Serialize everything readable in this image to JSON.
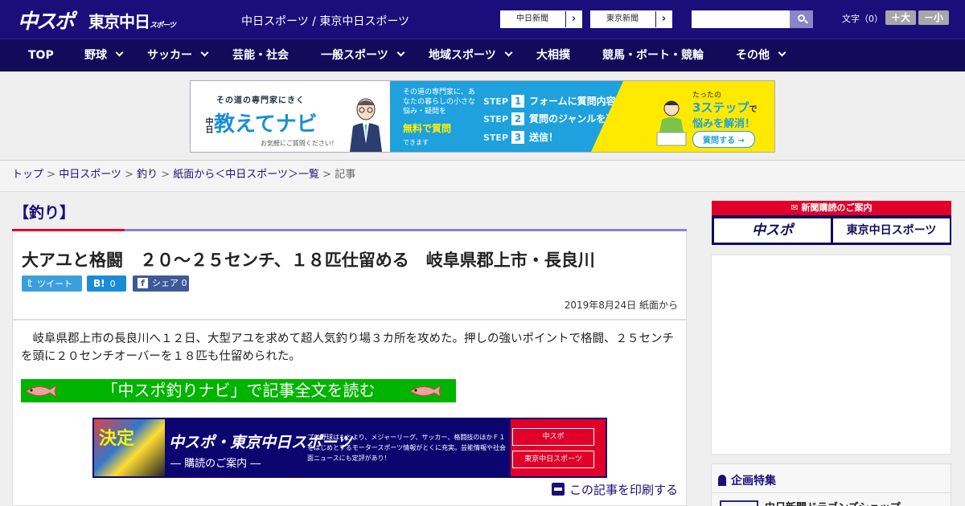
{
  "header": {
    "logo_main": "中スポ",
    "logo_tokyo": "東京中日",
    "logo_tokyo_sub": "スポーツ",
    "site_title": "中日スポーツ / 東京中日スポーツ",
    "ext_links": [
      "中日新聞",
      "東京新聞"
    ],
    "search_placeholder": "",
    "font_size_label": "文字（0）",
    "font_bigger": "＋大",
    "font_smaller": "－小"
  },
  "nav": {
    "items": [
      {
        "label": "TOP",
        "has_menu": false
      },
      {
        "label": "野球",
        "has_menu": true
      },
      {
        "label": "サッカー",
        "has_menu": true
      },
      {
        "label": "芸能・社会",
        "has_menu": false
      },
      {
        "label": "一般スポーツ",
        "has_menu": true
      },
      {
        "label": "地域スポーツ",
        "has_menu": true
      },
      {
        "label": "大相撲",
        "has_menu": false
      },
      {
        "label": "競馬・ボート・競輪",
        "has_menu": false
      },
      {
        "label": "その他",
        "has_menu": true
      }
    ]
  },
  "ad_banner": {
    "tagline": "その道の専門家にきく",
    "brand_prefix": "中日",
    "brand": "教えてナビ",
    "note": "お気軽にご質問ください！",
    "mid_text": "その道の専門家に、あなたの暮らしの小さな悩み・疑問を",
    "free": "無料で質問",
    "can": "できます",
    "step_label": "STEP",
    "steps": [
      {
        "num": "1",
        "text": "フォームに質問内容を入力"
      },
      {
        "num": "2",
        "text": "質問のジャンルを選択"
      },
      {
        "num": "3",
        "text": "送信！"
      }
    ],
    "right_small": "たったの",
    "right_big": "3ステップ",
    "right_de": "で",
    "right_solve": "悩みを解消！",
    "right_button": "質問する →"
  },
  "breadcrumb": {
    "items": [
      "トップ",
      "中日スポーツ",
      "釣り",
      "紙面から＜中日スポーツ＞一覧"
    ],
    "current": "記事",
    "sep": " > "
  },
  "article": {
    "category": "【釣り】",
    "headline": "大アユと格闘　２０～２５センチ、１８匹仕留める　岐阜県郡上市・長良川",
    "share_twitter": "ツイート",
    "share_hatena_count": "0",
    "share_facebook": "シェア",
    "share_facebook_count": "0",
    "dateline": "2019年8月24日 紙面から",
    "lead": "岐阜県郡上市の長良川へ１２日、大型アユを求めて超人気釣り場３カ所を攻めた。押しの強いポイントで格闘、２５センチを頭に２０センチオーバーを１８匹も仕留められた。",
    "navi_link": "「中スポ釣りナビ」で記事全文を読む",
    "print": "この記事を印刷する"
  },
  "promo": {
    "title": "中スポ・東京中日スポーツ",
    "subtitle": "― 購読のご案内 ―",
    "desc": "プロ野球はもとより、メジャーリーグ、サッカー、格闘技のほかＦ１をはじめとするモータースポーツ情報がとくに充実。芸能情報や社会面ニュースにも定評があり！",
    "btn1": "中スポ",
    "btn2": "東京中日スポーツ",
    "thumb_text": "決定"
  },
  "sidebar": {
    "subscribe_header": "新聞購読のご案内",
    "subscribe_btn1": "中スポ",
    "subscribe_btn2": "東京中日スポーツ",
    "feature_title": "企画特集",
    "feature_item": "中日新聞ドラゴンズショップ"
  },
  "colors": {
    "header_bg": "#1b0e7a",
    "nav_bg": "#130b5a",
    "accent_red": "#e0002a",
    "navi_green": "#00b400"
  }
}
